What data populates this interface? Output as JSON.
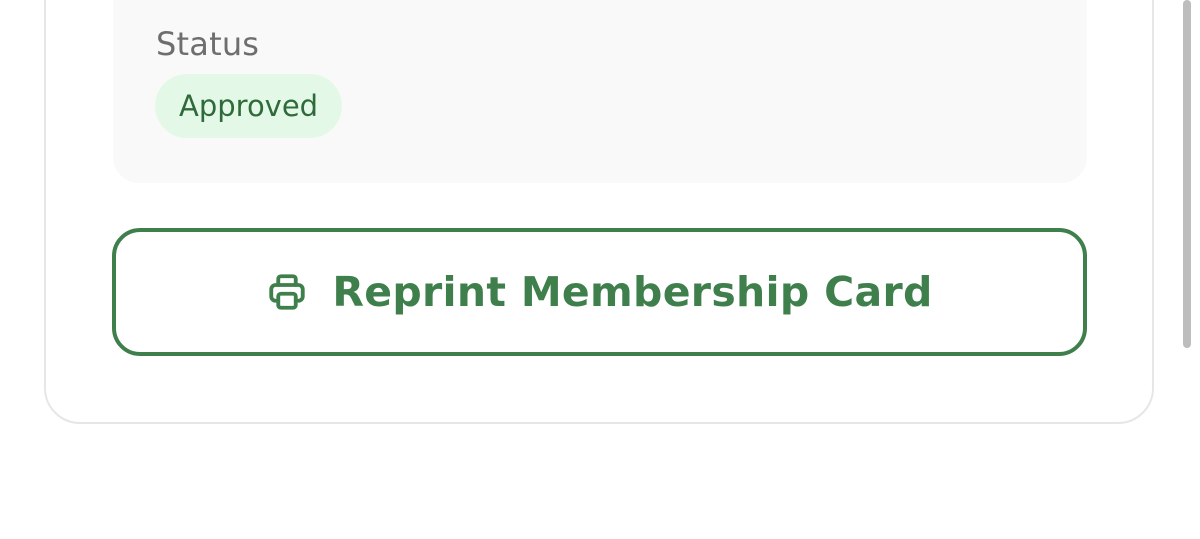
{
  "details": {
    "status_label": "Status",
    "status_value": "Approved"
  },
  "actions": {
    "reprint_label": "Reprint Membership Card",
    "reprint_icon": "printer-icon"
  },
  "colors": {
    "accent_green": "#3f7f4c",
    "badge_bg": "#e4f8e8",
    "badge_text": "#2f6b3a",
    "panel_bg": "#f9f9f9"
  }
}
